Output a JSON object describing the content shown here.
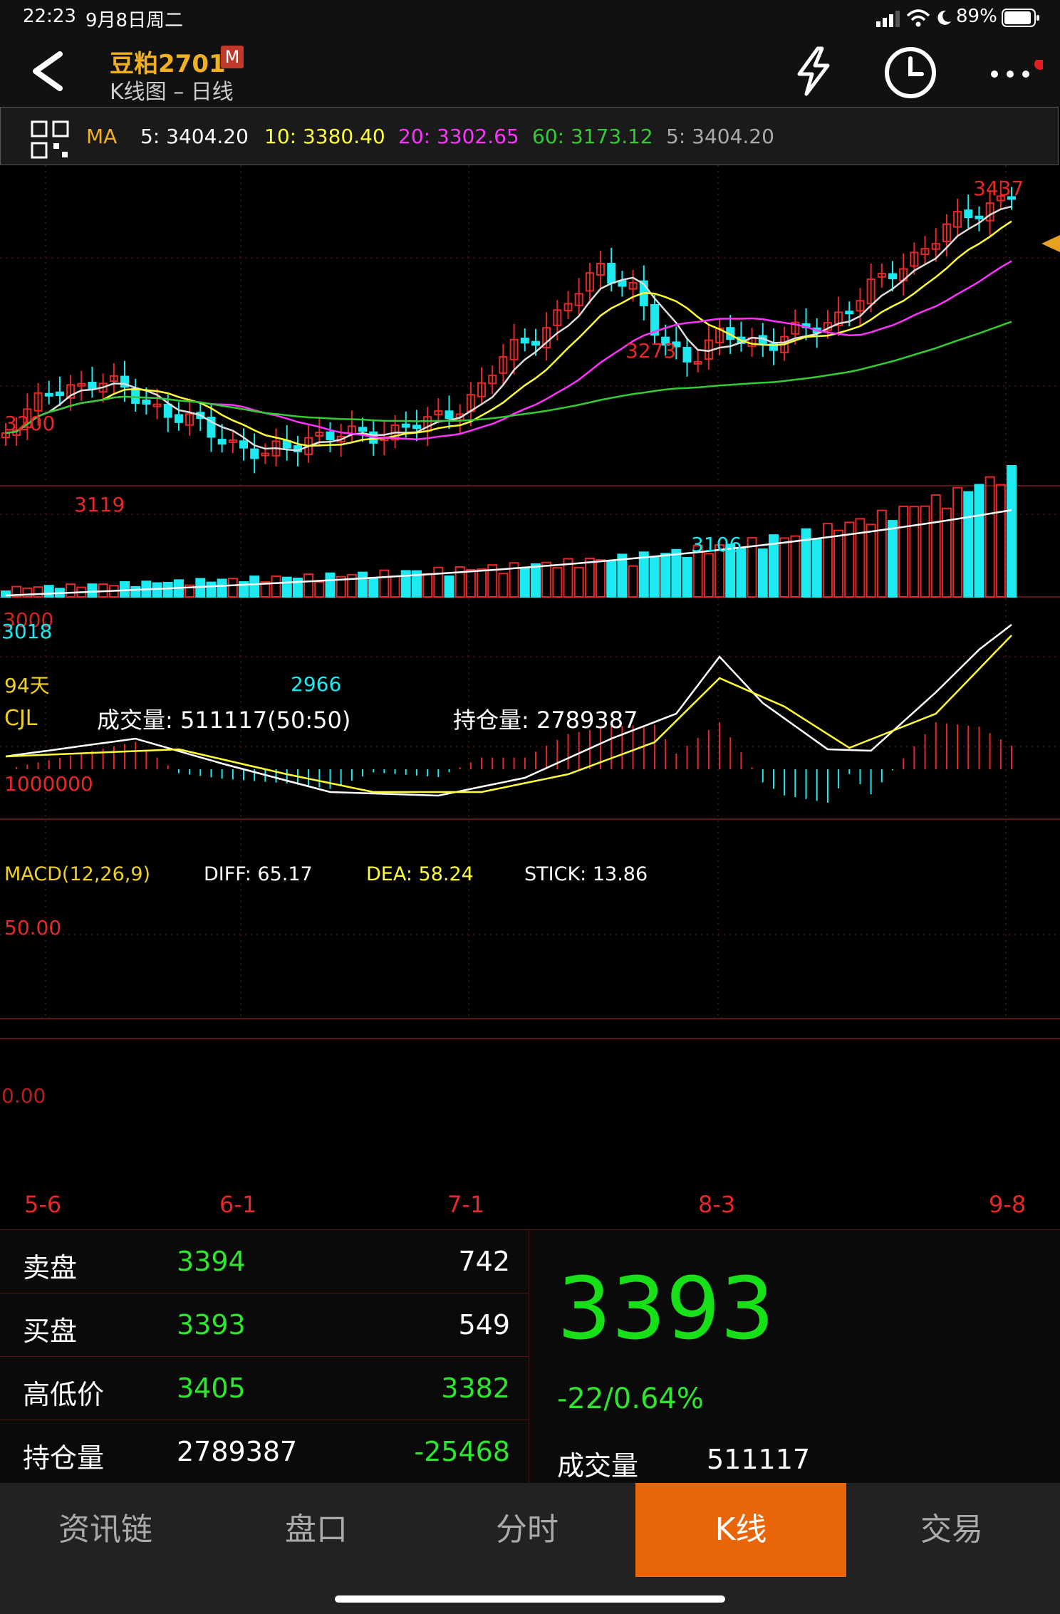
{
  "status": {
    "time": "22:23",
    "date": "9月8日周二",
    "battery": "89%"
  },
  "header": {
    "title": "豆粕2701",
    "badge": "M",
    "subtitle": "K线图 – 日线",
    "icons": [
      "back-arrow-icon",
      "lightning-icon",
      "clock-icon",
      "more-icon"
    ]
  },
  "ma": {
    "label": "MA",
    "ma5": "5: 3404.20",
    "ma10": "10: 3380.40",
    "ma20": "20: 3302.65",
    "ma60": "60: 3173.12",
    "ma5b": "5: 3404.20",
    "colors": {
      "ma5": "#ffffff",
      "ma10": "#ffff33",
      "ma20": "#ff33ff",
      "ma60": "#33cc33"
    }
  },
  "kline": {
    "days_label": "94天",
    "y_tick": "3200",
    "y_tick_partial": "3000",
    "peaks": [
      "3119",
      "3273",
      "3437"
    ],
    "troughs": [
      "3018",
      "2966",
      "3106"
    ]
  },
  "volume": {
    "label": "CJL",
    "vol_text": "成交量: 511117(50:50)",
    "oi_text": "持仓量: 2789387",
    "y_tick": "1000000"
  },
  "macd": {
    "label": "MACD(12,26,9)",
    "diff": "DIFF: 65.17",
    "dea": "DEA: 58.24",
    "stick": "STICK: 13.86",
    "y_tick_50": "50.00",
    "y_tick_0": "0.00"
  },
  "dates": [
    "5-6",
    "6-1",
    "7-1",
    "8-3",
    "9-8"
  ],
  "quote": {
    "sell": {
      "label": "卖盘",
      "price": "3394",
      "qty": "742"
    },
    "buy": {
      "label": "买盘",
      "price": "3393",
      "qty": "549"
    },
    "hilo": {
      "label": "高低价",
      "high": "3405",
      "low": "3382"
    },
    "oi": {
      "label": "持仓量",
      "value": "2789387",
      "change": "-25468"
    },
    "last": "3393",
    "change": "-22/0.64%",
    "vol_label": "成交量",
    "vol_value": "511117"
  },
  "tabs": [
    "资讯链",
    "盘口",
    "分时",
    "K线",
    "交易"
  ],
  "colors": {
    "up": "#e62828",
    "down": "#1de9f0",
    "accent": "#e8650a",
    "gain_green": "#18e018"
  }
}
